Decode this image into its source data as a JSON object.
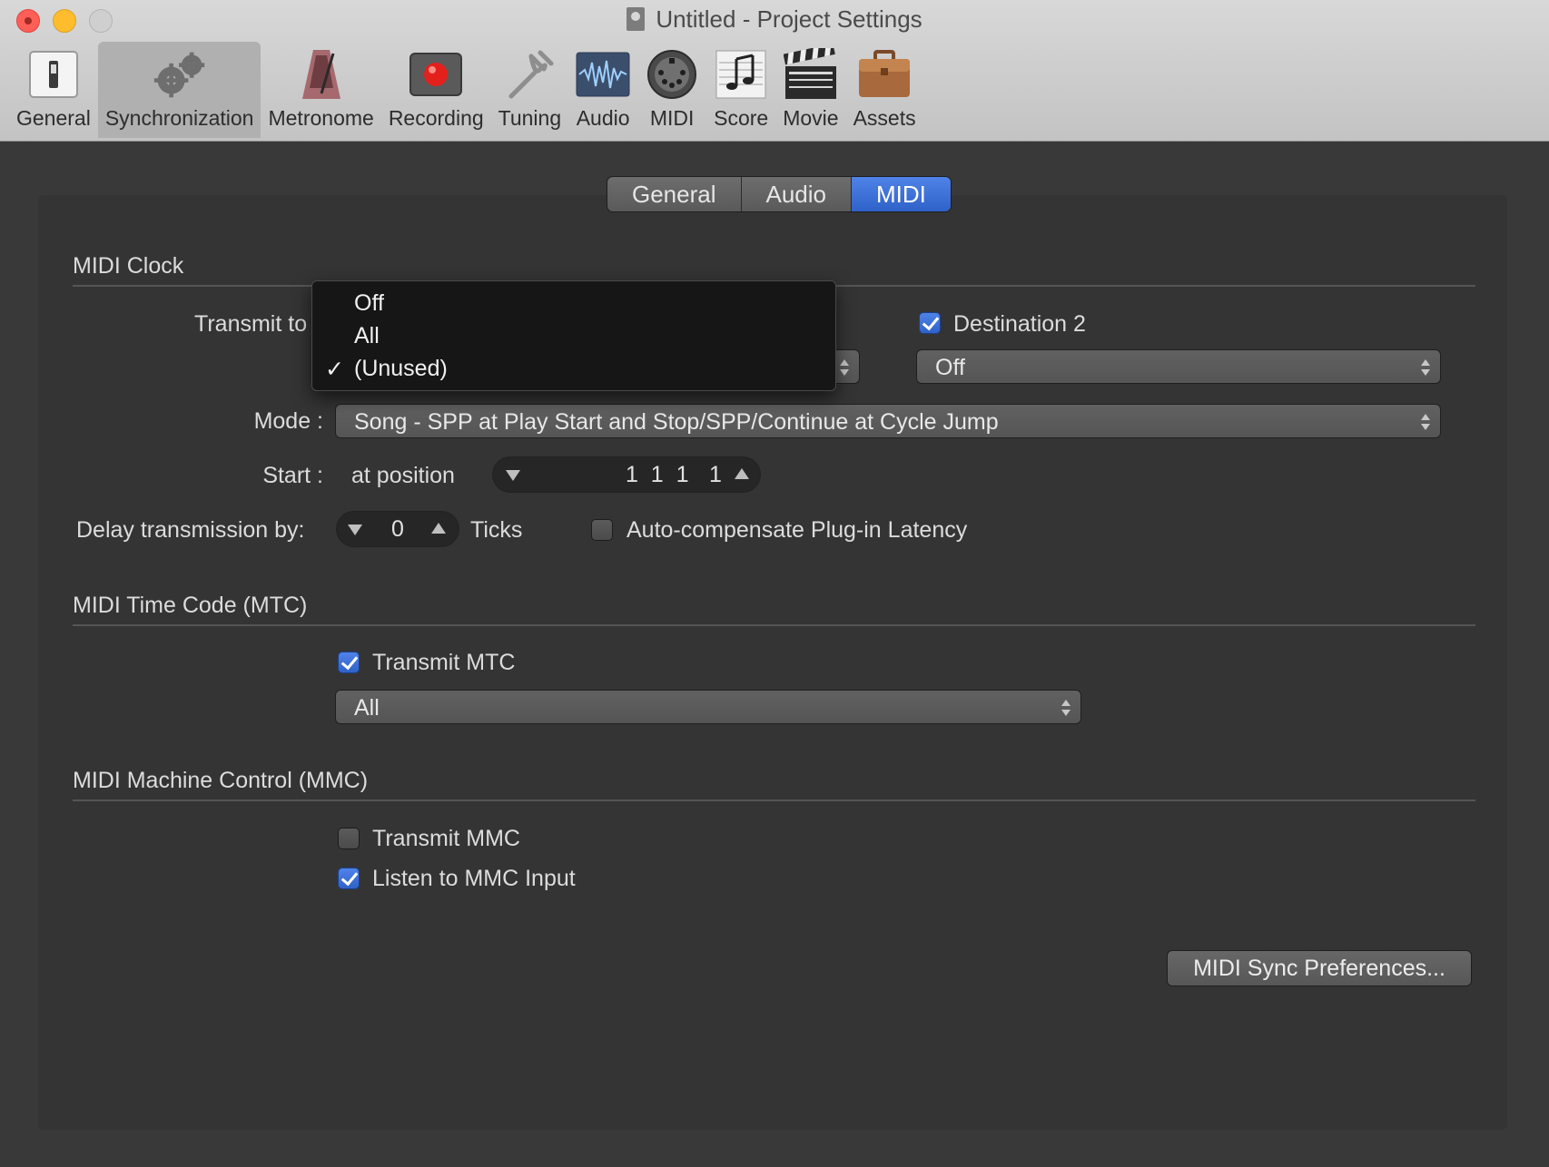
{
  "window": {
    "title": "Untitled - Project Settings"
  },
  "toolbar": {
    "items": [
      {
        "label": "General",
        "icon": "switch-icon"
      },
      {
        "label": "Synchronization",
        "icon": "gears-icon",
        "selected": true
      },
      {
        "label": "Metronome",
        "icon": "metronome-icon"
      },
      {
        "label": "Recording",
        "icon": "record-icon"
      },
      {
        "label": "Tuning",
        "icon": "tuning-fork-icon"
      },
      {
        "label": "Audio",
        "icon": "waveform-icon"
      },
      {
        "label": "MIDI",
        "icon": "midi-connector-icon"
      },
      {
        "label": "Score",
        "icon": "score-icon"
      },
      {
        "label": "Movie",
        "icon": "clapperboard-icon"
      },
      {
        "label": "Assets",
        "icon": "briefcase-icon"
      }
    ]
  },
  "tabs": {
    "items": [
      "General",
      "Audio",
      "MIDI"
    ],
    "active": "MIDI"
  },
  "midi_clock": {
    "title": "MIDI Clock",
    "transmit_label": "Transmit to",
    "destination2_label": "Destination 2",
    "destination2_checked": true,
    "destination2_value": "Off",
    "dropdown_options": [
      {
        "label": "Off",
        "checked": false
      },
      {
        "label": "All",
        "checked": false
      },
      {
        "label": "(Unused)",
        "checked": true
      }
    ],
    "checkmark": "✓",
    "mode_label": "Mode :",
    "mode_value": "Song - SPP at Play Start and Stop/SPP/Continue at Cycle Jump",
    "start_label": "Start :",
    "start_at_text": "at position",
    "start_position": "1  1  1",
    "start_position_tick": "1",
    "delay_label": "Delay transmission by:",
    "delay_value": "0",
    "delay_unit": "Ticks",
    "autocomp_label": "Auto-compensate Plug-in Latency",
    "autocomp_checked": false
  },
  "mtc": {
    "title": "MIDI Time Code (MTC)",
    "transmit_label": "Transmit MTC",
    "transmit_checked": true,
    "destination_value": "All"
  },
  "mmc": {
    "title": "MIDI Machine Control (MMC)",
    "transmit_label": "Transmit MMC",
    "transmit_checked": false,
    "listen_label": "Listen to MMC Input",
    "listen_checked": true
  },
  "buttons": {
    "sync_prefs": "MIDI Sync Preferences..."
  },
  "colors": {
    "accent": "#3a6fd8",
    "background": "#393939",
    "toolbar": "#c8c8c8"
  }
}
